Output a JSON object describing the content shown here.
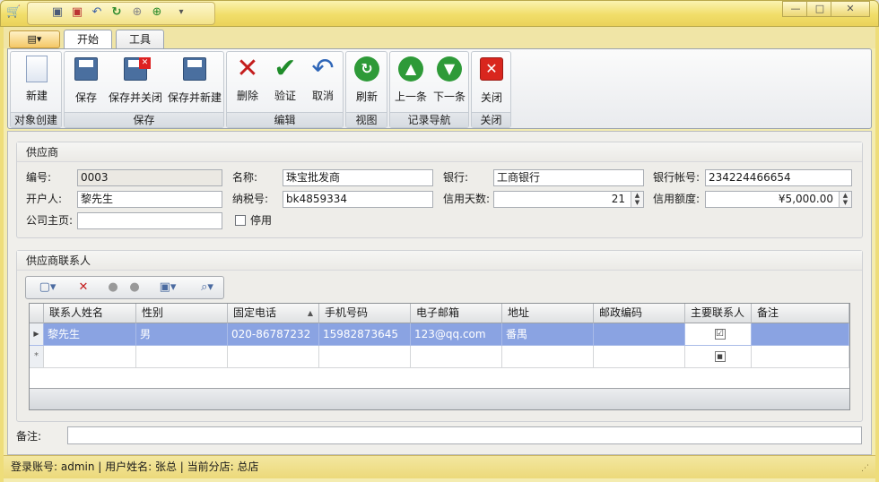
{
  "titlebar": {
    "quick_access": [
      "app-icon",
      "save-icon",
      "save-close-icon",
      "undo-icon",
      "refresh-icon",
      "up-icon",
      "down-icon",
      "dropdown-icon"
    ],
    "win_min": "—",
    "win_max": "□",
    "win_close": "✕"
  },
  "ribbon": {
    "tabs": [
      {
        "label": "开始",
        "active": true
      },
      {
        "label": "工具",
        "active": false
      }
    ],
    "groups": [
      {
        "title": "对象创建",
        "buttons": [
          {
            "label": "新建"
          }
        ]
      },
      {
        "title": "保存",
        "buttons": [
          {
            "label": "保存"
          },
          {
            "label": "保存并关闭"
          },
          {
            "label": "保存并新建"
          }
        ]
      },
      {
        "title": "编辑",
        "buttons": [
          {
            "label": "删除"
          },
          {
            "label": "验证"
          },
          {
            "label": "取消"
          }
        ]
      },
      {
        "title": "视图",
        "buttons": [
          {
            "label": "刷新"
          }
        ]
      },
      {
        "title": "记录导航",
        "buttons": [
          {
            "label": "上一条"
          },
          {
            "label": "下一条"
          }
        ]
      },
      {
        "title": "关闭",
        "buttons": [
          {
            "label": "关闭"
          }
        ]
      }
    ]
  },
  "supplier": {
    "title": "供应商",
    "code_label": "编号:",
    "code": "0003",
    "name_label": "名称:",
    "name": "珠宝批发商",
    "bank_label": "银行:",
    "bank": "工商银行",
    "account_label": "银行帐号:",
    "account": "234224466654",
    "opener_label": "开户人:",
    "opener": "黎先生",
    "tax_label": "纳税号:",
    "tax": "bk4859334",
    "credit_days_label": "信用天数:",
    "credit_days": "21",
    "credit_limit_label": "信用额度:",
    "credit_limit": "¥5,000.00",
    "homepage_label": "公司主页:",
    "homepage": "",
    "disabled_label": "停用"
  },
  "contacts": {
    "title": "供应商联系人",
    "columns": [
      "联系人姓名",
      "性别",
      "固定电话",
      "手机号码",
      "电子邮箱",
      "地址",
      "邮政编码",
      "主要联系人",
      "备注"
    ],
    "rows": [
      {
        "name": "黎先生",
        "gender": "男",
        "phone": "020-86787232",
        "mobile": "15982873645",
        "email": "123@qq.com",
        "address": "番禺",
        "zip": "",
        "primary": "☑",
        "note": ""
      }
    ],
    "sort_indicator": "▲"
  },
  "notes": {
    "label": "备注:",
    "value": ""
  },
  "status": {
    "text": "登录账号: admin  |  用户姓名: 张总  |  当前分店: 总店"
  }
}
